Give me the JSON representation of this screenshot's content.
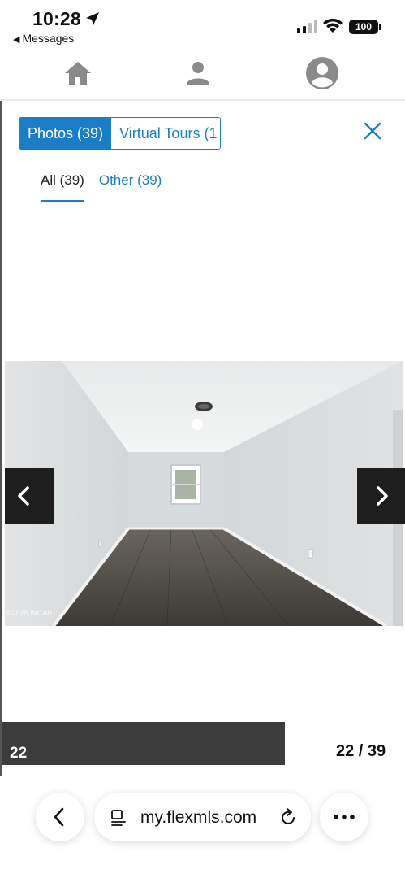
{
  "status": {
    "time": "10:28",
    "back_app": "Messages",
    "battery": "100"
  },
  "nav": {
    "icons": [
      "home-icon",
      "person-icon",
      "account-circle-icon"
    ]
  },
  "tabs": {
    "photos": "Photos (39)",
    "virtual_tours": "Virtual Tours (1"
  },
  "subtabs": {
    "all": "All (39)",
    "other": "Other (39)"
  },
  "photo": {
    "copyright": "©2025 WCAR"
  },
  "gallery": {
    "caption": "22",
    "counter": "22 / 39"
  },
  "browser": {
    "url": "my.flexmls.com"
  },
  "colors": {
    "accent": "#1a7dc6",
    "caption_bar": "#3c3c3c"
  }
}
